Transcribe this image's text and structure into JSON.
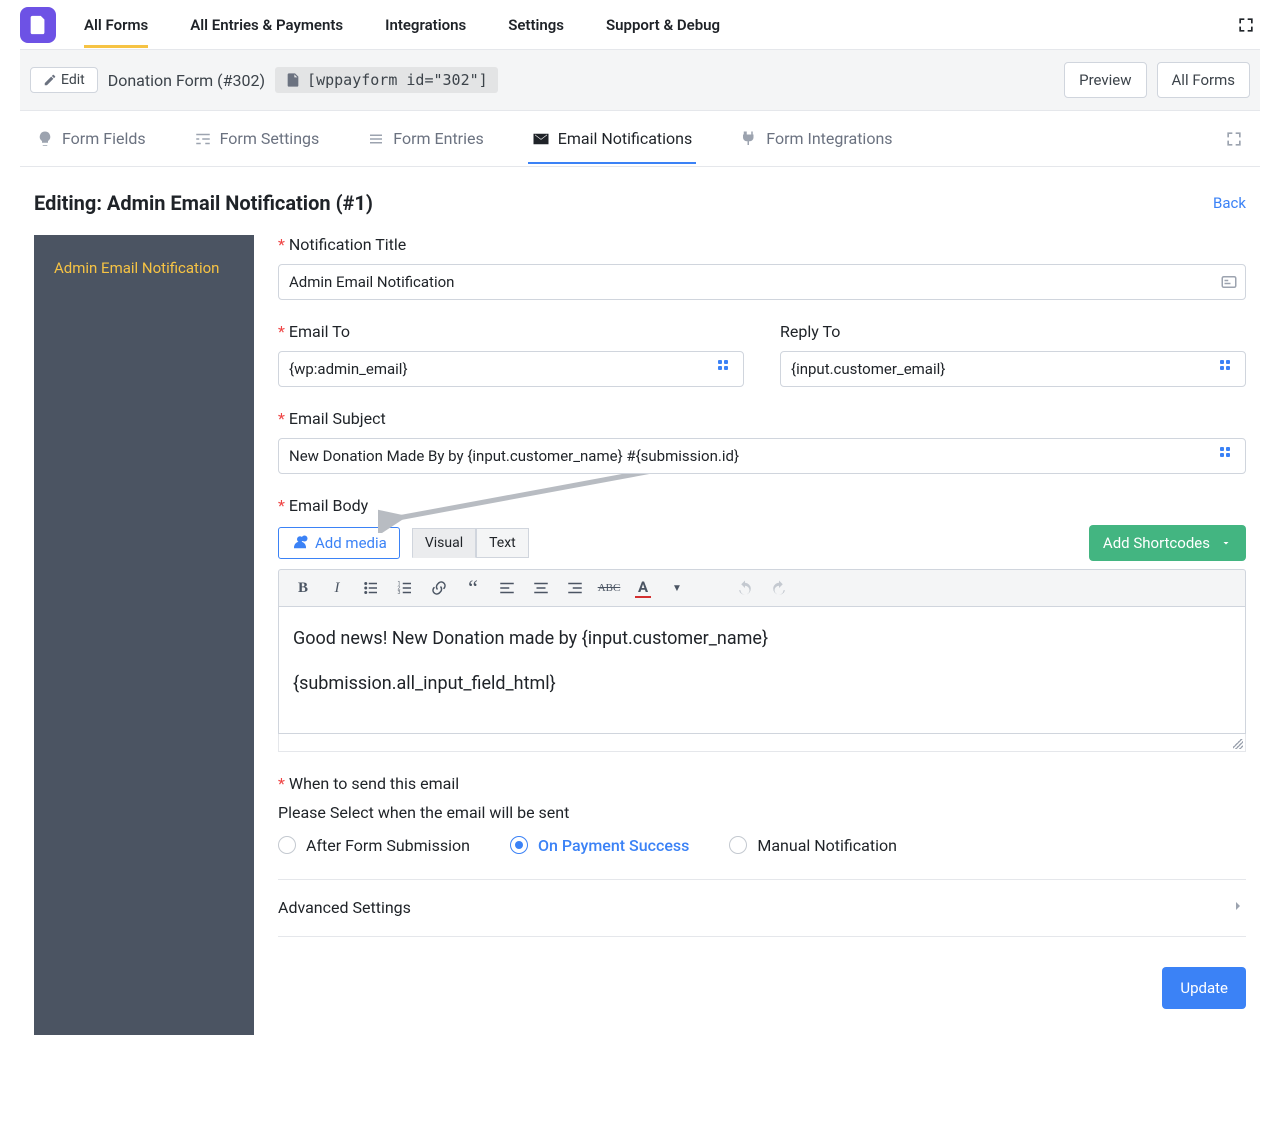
{
  "top_tabs": [
    "All Forms",
    "All Entries & Payments",
    "Integrations",
    "Settings",
    "Support & Debug"
  ],
  "top_tabs_active_index": 0,
  "subbar": {
    "edit_label": "Edit",
    "form_name": "Donation Form (#302)",
    "shortcode": "[wppayform id=\"302\"]",
    "preview_btn": "Preview",
    "all_forms_btn": "All Forms"
  },
  "form_tabs": [
    "Form Fields",
    "Form Settings",
    "Form Entries",
    "Email Notifications",
    "Form Integrations"
  ],
  "form_tabs_active_index": 3,
  "heading": "Editing: Admin Email Notification (#1)",
  "back_link": "Back",
  "sidepanel": {
    "items": [
      "Admin Email Notification"
    ]
  },
  "fields": {
    "notification_title": {
      "label": "Notification Title",
      "value": "Admin Email Notification"
    },
    "email_to": {
      "label": "Email To",
      "value": "{wp:admin_email}"
    },
    "reply_to": {
      "label": "Reply To",
      "value": "{input.customer_email}"
    },
    "subject": {
      "label": "Email Subject",
      "value": "New Donation Made By by {input.customer_name} #{submission.id}"
    },
    "body": {
      "label": "Email Body",
      "add_media_btn": "Add media",
      "tab_visual": "Visual",
      "tab_text": "Text",
      "add_shortcodes_btn": "Add Shortcodes",
      "content_line1": "Good news! New Donation made by {input.customer_name}",
      "content_line2": "{submission.all_input_field_html}"
    },
    "when": {
      "label": "When to send this email",
      "helper": "Please Select when the email will be sent",
      "options": [
        "After Form Submission",
        "On Payment Success",
        "Manual Notification"
      ],
      "selected_index": 1
    },
    "advanced_label": "Advanced Settings"
  },
  "update_btn": "Update"
}
